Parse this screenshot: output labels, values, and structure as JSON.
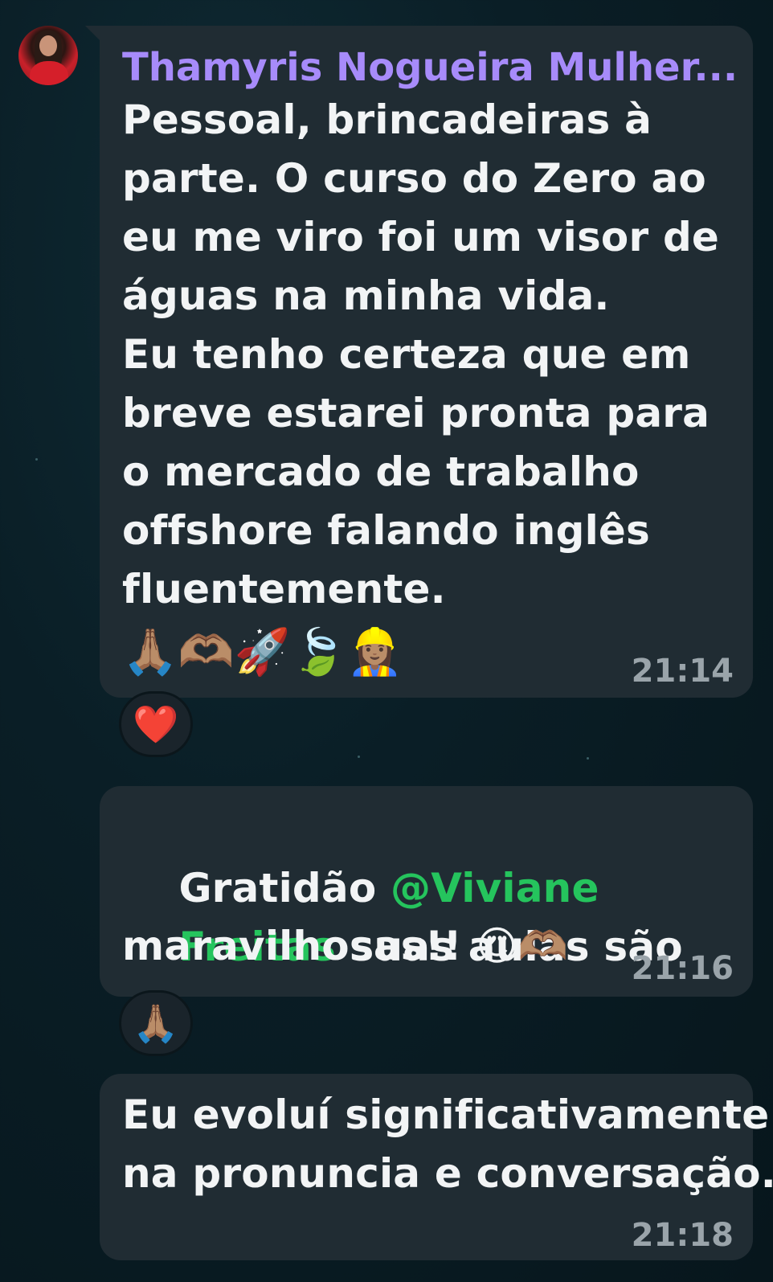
{
  "messages": [
    {
      "sender": "Thamyris Nogueira Mulher...",
      "lines": [
        "Pessoal, brincadeiras à",
        "parte. O curso do Zero ao",
        "eu me viro foi um visor de",
        "águas na minha vida.",
        "Eu tenho certeza que em",
        "breve estarei pronta para",
        "o mercado de trabalho",
        "offshore falando inglês",
        "fluentemente."
      ],
      "emojis": "🙏🏽🫶🏽🚀🍃👷🏽‍♀️",
      "time": "21:14",
      "reaction": "❤️"
    },
    {
      "text_before": "Gratidão ",
      "mention_line1": "@Viviane",
      "mention_line2": "Freitas",
      "text_after": " suas aulas são",
      "line3": "maravilhosas!! 😍🫶🏽",
      "time": "21:16",
      "reaction": "🙏🏽"
    },
    {
      "lines": [
        "Eu evoluí significativamente",
        "na pronuncia e conversação."
      ],
      "time": "21:18"
    }
  ]
}
